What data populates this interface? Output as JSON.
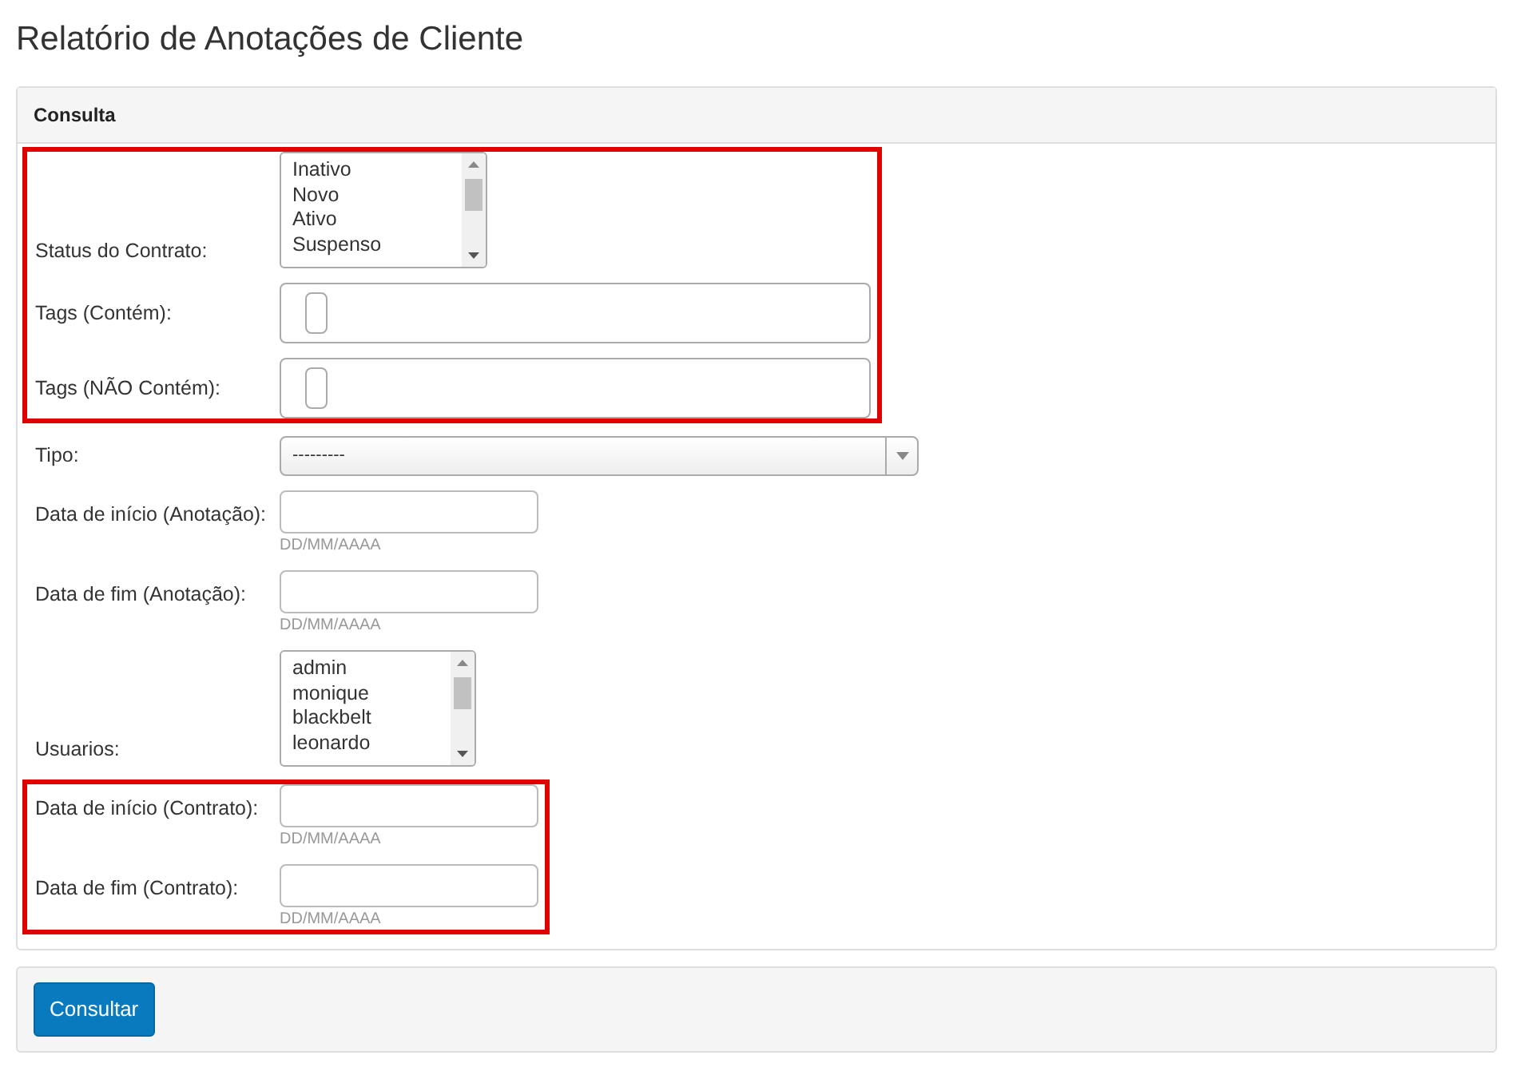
{
  "page_title": "Relatório de Anotações de Cliente",
  "panel": {
    "title": "Consulta"
  },
  "sections": [
    {
      "highlighted": true,
      "fields": [
        {
          "kind": "listbox",
          "label": "Status do Contrato:",
          "options": [
            "Inativo",
            "Novo",
            "Ativo",
            "Suspenso"
          ]
        },
        {
          "kind": "tags",
          "label": "Tags (Contém):"
        },
        {
          "kind": "tags",
          "label": "Tags (NÃO Contém):"
        }
      ]
    },
    {
      "highlighted": false,
      "fields": [
        {
          "kind": "select",
          "label": "Tipo:",
          "value": "---------"
        },
        {
          "kind": "date",
          "label": "Data de início (Anotação):",
          "hint": "DD/MM/AAAA"
        },
        {
          "kind": "date",
          "label": "Data de fim (Anotação):",
          "hint": "DD/MM/AAAA"
        },
        {
          "kind": "listbox",
          "label": "Usuarios:",
          "options": [
            "admin",
            "monique",
            "blackbelt",
            "leonardo"
          ]
        }
      ]
    },
    {
      "highlighted": true,
      "fields": [
        {
          "kind": "date",
          "label": "Data de início (Contrato):",
          "hint": "DD/MM/AAAA"
        },
        {
          "kind": "date",
          "label": "Data de fim (Contrato):",
          "hint": "DD/MM/AAAA"
        }
      ]
    }
  ],
  "submit_button": "Consultar"
}
